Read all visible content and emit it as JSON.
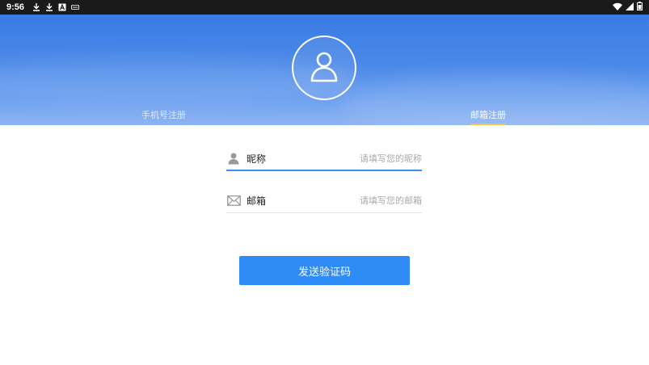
{
  "status_bar": {
    "time": "9:56",
    "left_icons": [
      "download-icon",
      "download-icon",
      "a-icon",
      "shield-icon"
    ],
    "right_icons": [
      "wifi-icon",
      "signal-icon",
      "battery-icon"
    ]
  },
  "header": {
    "avatar_icon": "user-icon",
    "tabs": [
      {
        "label": "手机号注册",
        "active": false
      },
      {
        "label": "邮箱注册",
        "active": true
      }
    ],
    "active_indicator_color": "#f5c542"
  },
  "form": {
    "nickname": {
      "label": "昵称",
      "placeholder": "请填写您的昵称",
      "value": "",
      "icon": "user-icon"
    },
    "email": {
      "label": "邮箱",
      "placeholder": "请填写您的邮箱",
      "value": "",
      "icon": "mail-icon"
    }
  },
  "actions": {
    "send_code_label": "发送验证码"
  },
  "colors": {
    "accent": "#2f8bf5",
    "focus_underline": "#3a8ef0"
  }
}
